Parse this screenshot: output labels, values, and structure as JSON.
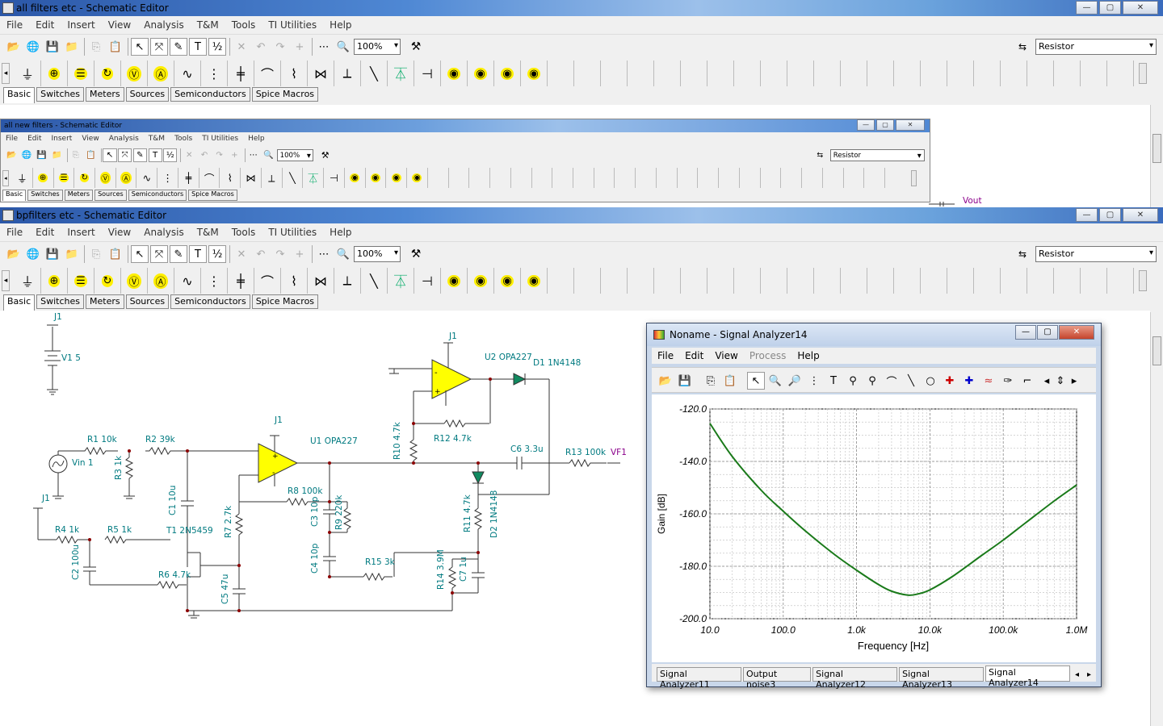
{
  "windows": [
    {
      "title": "all filters etc - Schematic Editor"
    },
    {
      "title": "all new filters - Schematic Editor"
    },
    {
      "title": "bpfilters etc - Schematic Editor"
    }
  ],
  "menu": [
    "File",
    "Edit",
    "Insert",
    "View",
    "Analysis",
    "T&M",
    "Tools",
    "TI Utilities",
    "Help"
  ],
  "toolbar": {
    "zoom": "100%",
    "component": "Resistor"
  },
  "small_toolbar": {
    "zoom": "100%",
    "component": "Resistor"
  },
  "component_tabs": [
    "Basic",
    "Switches",
    "Meters",
    "Sources",
    "Semiconductors",
    "Spice Macros"
  ],
  "window_buttons": {
    "minimize": "—",
    "maximize": "▢",
    "close": "✕"
  },
  "background_label": "Vout",
  "schematic_labels": {
    "j1_top": "J1",
    "v1": "V1 5",
    "j1_opamp1": "J1",
    "j1_opamp2": "J1",
    "u2": "U2 OPA227",
    "d1": "D1 1N4148",
    "r10": "R10 4.7k",
    "r12": "R12 4.7k",
    "c6": "C6 3.3u",
    "r13": "R13 100k",
    "vf1": "VF1",
    "r1": "R1 10k",
    "r2": "R2 39k",
    "u1": "U1 OPA227",
    "vin": "Vin 1",
    "r3": "R3 1k",
    "c1": "C1 10u",
    "r8": "R8 100k",
    "j1_left": "J1",
    "r7": "R7 2.7k",
    "c3": "C3 10p",
    "r9": "R9 220k",
    "r11": "R11 4.7k",
    "d2": "D2 1N4148",
    "r4": "R4 1k",
    "r5": "R5 1k",
    "t1": "T1 2N5459",
    "c2": "C2 100u",
    "r6": "R6 4.7k",
    "c4": "C4 10p",
    "r15": "R15 3k",
    "r14": "R14 3.9M",
    "c7": "C7 1u",
    "c5": "C5 47u"
  },
  "signal_analyzer": {
    "title": "Noname - Signal Analyzer14",
    "menu": [
      "File",
      "Edit",
      "View",
      "Process",
      "Help"
    ],
    "menu_disabled": [
      "Process"
    ],
    "tabs": [
      "Signal Analyzer11",
      "Output noise3",
      "Signal Analyzer12",
      "Signal Analyzer13",
      "Signal Analyzer14"
    ],
    "active_tab": "Signal Analyzer14"
  },
  "chart_data": {
    "type": "line",
    "title": "",
    "xlabel": "Frequency [Hz]",
    "ylabel": "Gain [dB]",
    "xscale": "log",
    "xlim": [
      10,
      1000000
    ],
    "ylim": [
      -200,
      -120
    ],
    "x_ticks": [
      "10.0",
      "100.0",
      "1.0k",
      "10.0k",
      "100.0k",
      "1.0M"
    ],
    "y_ticks": [
      "-120.0",
      "-140.0",
      "-160.0",
      "-180.0",
      "-200.0"
    ],
    "grid": true,
    "series": [
      {
        "color": "#1a7a1a",
        "x": [
          10,
          20,
          50,
          100,
          200,
          500,
          1000,
          2000,
          3000,
          5000,
          7000,
          10000,
          20000,
          50000,
          100000,
          200000,
          500000,
          1000000
        ],
        "y": [
          -125.5,
          -138,
          -151,
          -159,
          -166.5,
          -175.5,
          -181.5,
          -187,
          -189.5,
          -191,
          -190.5,
          -189,
          -184,
          -176,
          -170,
          -163.5,
          -155,
          -149
        ]
      }
    ]
  }
}
